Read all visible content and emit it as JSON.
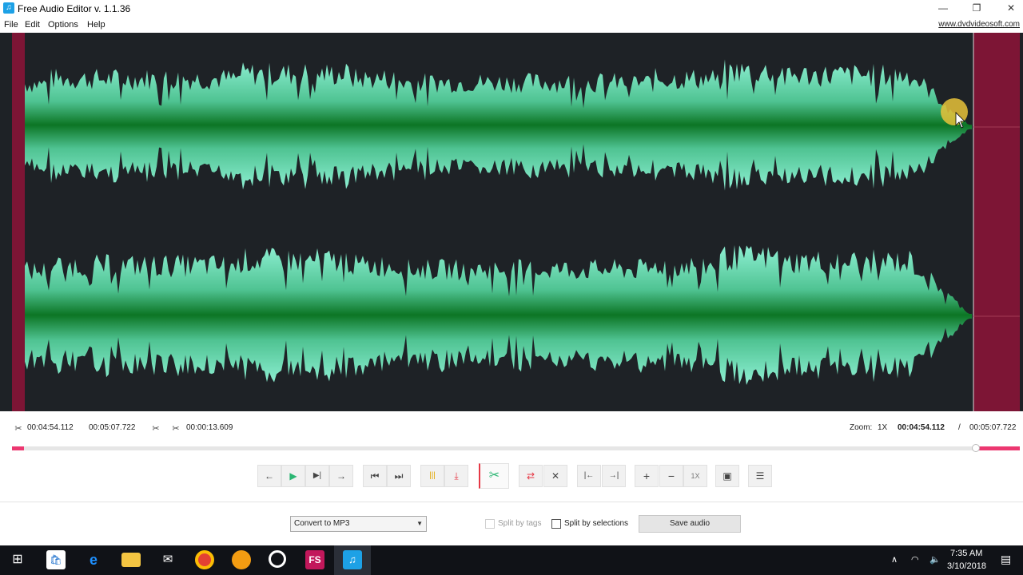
{
  "window": {
    "title": "Free Audio Editor v. 1.1.36",
    "minimize_glyph": "—",
    "restore_glyph": "❐",
    "close_glyph": "✕"
  },
  "menu": {
    "items": [
      "File",
      "Edit",
      "Options",
      "Help"
    ],
    "site_link": "www.dvdvideosoft.com"
  },
  "waveform": {
    "background_color": "#1e2226",
    "wave_color_light": "#7fe3c7",
    "wave_color_dark": "#0f7a2a",
    "unselected_region_color": "#7d1535"
  },
  "selection": {
    "start": "00:04:54.112",
    "end": "00:05:07.722",
    "length": "00:00:13.609"
  },
  "zoom": {
    "label": "Zoom:",
    "value": "1X"
  },
  "position": {
    "current": "00:04:54.112",
    "separator": "/",
    "total": "00:05:07.722",
    "progress_fraction": 0.956
  },
  "toolbar": {
    "buttons": [
      {
        "name": "jump-back-button",
        "glyph": "←"
      },
      {
        "name": "play-button",
        "glyph": "▶"
      },
      {
        "name": "play-selection-button",
        "glyph": "▶|"
      },
      {
        "name": "jump-forward-button",
        "glyph": "→"
      },
      {
        "name": "previous-button",
        "glyph": "⏮"
      },
      {
        "name": "next-button",
        "glyph": "⏭"
      },
      {
        "name": "split-button",
        "glyph": "|||"
      },
      {
        "name": "insert-marker-button",
        "glyph": "⤓"
      },
      {
        "name": "cut-button",
        "glyph": "✂"
      },
      {
        "name": "fade-button",
        "glyph": "⇄"
      },
      {
        "name": "delete-selection-button",
        "glyph": "✕"
      },
      {
        "name": "select-to-start-button",
        "glyph": "|←"
      },
      {
        "name": "select-to-end-button",
        "glyph": "→|"
      },
      {
        "name": "zoom-in-button",
        "glyph": "+"
      },
      {
        "name": "zoom-out-button",
        "glyph": "−"
      },
      {
        "name": "zoom-reset-button",
        "glyph": "1X"
      },
      {
        "name": "image-button",
        "glyph": "▣"
      },
      {
        "name": "settings-button",
        "glyph": "☰"
      }
    ]
  },
  "output": {
    "format_selected": "Convert to MP3",
    "split_by_tags_label": "Split by tags",
    "split_by_selections_label": "Split by selections",
    "save_label": "Save audio"
  },
  "taskbar": {
    "icons": [
      "windows-start",
      "store",
      "edge",
      "file-explorer",
      "mail",
      "chrome",
      "app-orange",
      "media-player",
      "fs-app",
      "audio-editor"
    ],
    "fs_label": "FS",
    "time": "7:35 AM",
    "date": "3/10/2018"
  }
}
